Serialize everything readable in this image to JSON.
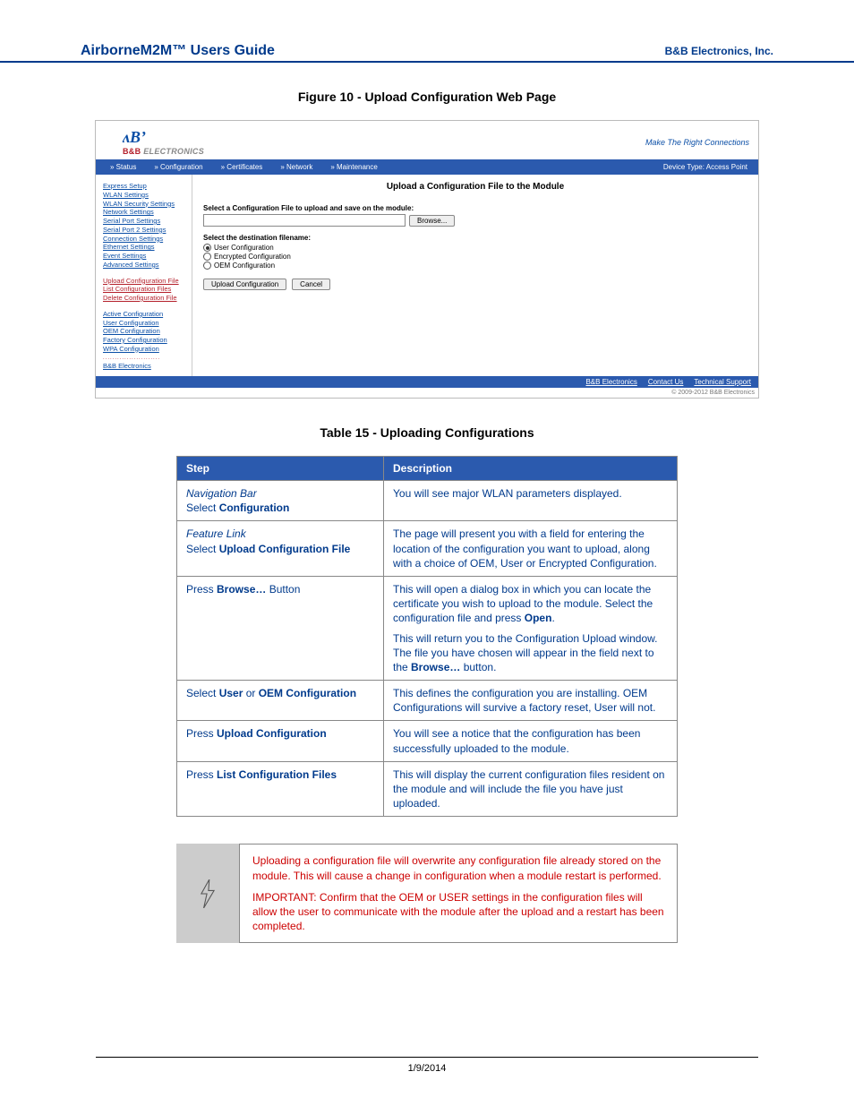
{
  "doc": {
    "title": "AirborneM2M™ Users Guide",
    "company": "B&B Electronics, Inc.",
    "figure_caption": "Figure 10 - Upload Configuration Web Page",
    "table_caption": "Table 15 - Uploading Configurations",
    "footer_date": "1/9/2014"
  },
  "screenshot": {
    "logo_b": "B",
    "logo_sub_brand": "B&B",
    "logo_sub_word": "ELECTRONICS",
    "tagline": "Make The Right Connections",
    "menu": [
      "Status",
      "Configuration",
      "Certificates",
      "Network",
      "Maintenance"
    ],
    "device_type": "Device Type: Access Point",
    "sidebar_primary": [
      "Express Setup",
      "WLAN Settings",
      "WLAN Security Settings",
      "Network Settings",
      "Serial Port Settings",
      "Serial Port 2 Settings",
      "Connection Settings",
      "Ethernet Settings",
      "Event Settings",
      "Advanced Settings"
    ],
    "sidebar_upload": [
      "Upload Configuration File",
      "List Configuration Files",
      "Delete Configuration File"
    ],
    "sidebar_config": [
      "Active Configuration",
      "User Configuration",
      "OEM Configuration",
      "Factory Configuration",
      "WPA Configuration"
    ],
    "sidebar_footer_link": "B&B Electronics",
    "main_title": "Upload a Configuration File to the Module",
    "field_label": "Select a Configuration File to upload and save on the module:",
    "browse_btn": "Browse...",
    "dest_label": "Select the destination filename:",
    "radios": [
      {
        "label": "User Configuration",
        "selected": true
      },
      {
        "label": "Encrypted Configuration",
        "selected": false
      },
      {
        "label": "OEM Configuration",
        "selected": false
      }
    ],
    "upload_btn": "Upload Configuration",
    "cancel_btn": "Cancel",
    "footer_links": [
      "B&B Electronics",
      "Contact Us",
      "Technical Support"
    ],
    "copyright": "© 2009-2012 B&B Electronics"
  },
  "table": {
    "headers": [
      "Step",
      "Description"
    ],
    "rows": [
      {
        "step_html": "<em class='nav'>Navigation Bar</em><br>Select <strong>Configuration</strong>",
        "desc": [
          "You will see major WLAN parameters displayed."
        ]
      },
      {
        "step_html": "<em class='nav'>Feature Link</em><br>Select <strong>Upload Configuration File</strong>",
        "desc": [
          "The page will present you with a field for entering the location of the configuration you want to upload, along with a  choice of OEM, User or Encrypted Configuration."
        ]
      },
      {
        "step_html": "Press <strong>Browse…</strong> Button",
        "desc": [
          "This will open a dialog box in which you can locate the certificate you wish to upload to the module. Select the configuration file and press <strong>Open</strong>.",
          "This will return you to the Configuration Upload window. The file you have chosen will appear in the field next to the <strong>Browse…</strong> button."
        ]
      },
      {
        "step_html": "Select <strong>User</strong> or <strong>OEM Configuration</strong>",
        "desc": [
          "This defines the configuration you are installing. OEM Configurations will survive a factory reset, User will not."
        ]
      },
      {
        "step_html": "Press <strong>Upload Configuration</strong>",
        "desc": [
          "You will see a notice that the configuration has been successfully uploaded to the module."
        ]
      },
      {
        "step_html": "Press <strong>List Configuration Files</strong>",
        "desc": [
          "This will display the current configuration files resident on the module and will include the file you have just uploaded."
        ]
      }
    ]
  },
  "warning": {
    "p1": "Uploading a configuration file will overwrite any configuration file already stored on the module. This will cause a change in configuration when a module restart is performed.",
    "p2": "IMPORTANT: Confirm that the OEM or USER settings in the configuration files will allow the user to communicate with the module after the upload and a restart has been completed."
  }
}
